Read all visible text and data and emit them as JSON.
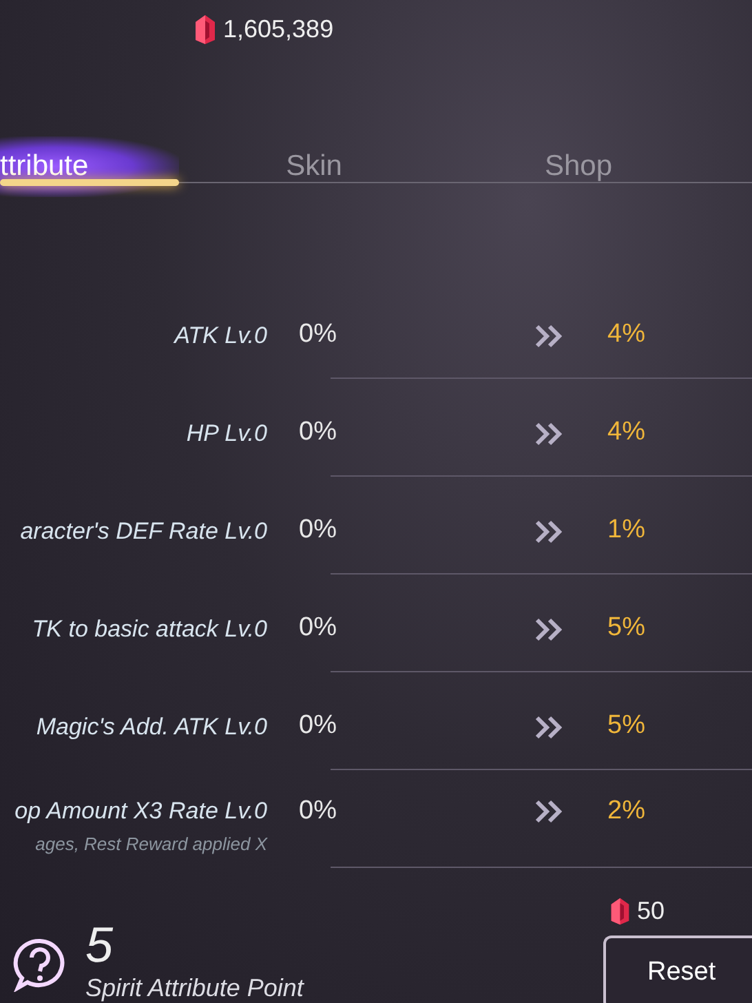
{
  "currency": {
    "amount": "1,605,389"
  },
  "tabs": [
    {
      "label": "ttribute",
      "selected": true
    },
    {
      "label": "Skin",
      "selected": false
    },
    {
      "label": "Shop",
      "selected": false
    }
  ],
  "attributes": [
    {
      "name": "ATK Lv.0",
      "current": "0%",
      "next": "4%"
    },
    {
      "name": "HP Lv.0",
      "current": "0%",
      "next": "4%"
    },
    {
      "name": "aracter's DEF Rate Lv.0",
      "current": "0%",
      "next": "1%"
    },
    {
      "name": "TK to basic attack Lv.0",
      "current": "0%",
      "next": "5%"
    },
    {
      "name": "Magic's Add. ATK Lv.0",
      "current": "0%",
      "next": "5%"
    },
    {
      "name": "op Amount X3 Rate Lv.0",
      "note": "ages, Rest Reward applied X",
      "current": "0%",
      "next": "2%"
    }
  ],
  "points": {
    "value": "5",
    "label": "Spirit Attribute Point"
  },
  "reset": {
    "cost": "50",
    "label": "Reset"
  }
}
